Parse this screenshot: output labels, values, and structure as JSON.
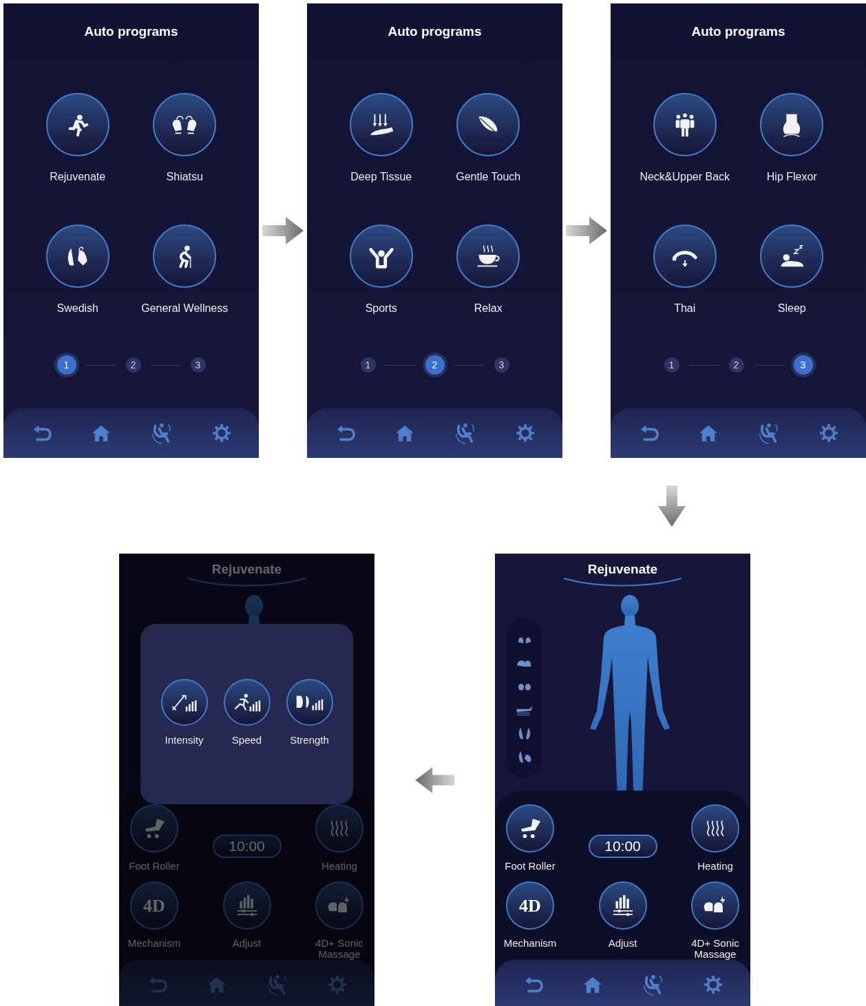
{
  "program_pages": [
    {
      "title": "Auto programs",
      "programs": [
        {
          "label": "Rejuvenate"
        },
        {
          "label": "Shiatsu"
        },
        {
          "label": "Swedish"
        },
        {
          "label": "General Wellness"
        }
      ],
      "pager": [
        {
          "label": "1",
          "selected": true
        },
        {
          "label": "2",
          "selected": false
        },
        {
          "label": "3",
          "selected": false
        }
      ]
    },
    {
      "title": "Auto programs",
      "programs": [
        {
          "label": "Deep Tissue"
        },
        {
          "label": "Gentle Touch"
        },
        {
          "label": "Sports"
        },
        {
          "label": "Relax"
        }
      ],
      "pager": [
        {
          "label": "1",
          "selected": false
        },
        {
          "label": "2",
          "selected": true
        },
        {
          "label": "3",
          "selected": false
        }
      ]
    },
    {
      "title": "Auto programs",
      "programs": [
        {
          "label": "Neck&Upper Back"
        },
        {
          "label": "Hip Flexor"
        },
        {
          "label": "Thai"
        },
        {
          "label": "Sleep"
        }
      ],
      "pager": [
        {
          "label": "1",
          "selected": false
        },
        {
          "label": "2",
          "selected": false
        },
        {
          "label": "3",
          "selected": true
        }
      ]
    }
  ],
  "program_screens": [
    {
      "title": "Rejuvenate",
      "dimmed": true,
      "timer": "10:00",
      "controls": [
        {
          "label": "Foot Roller"
        },
        {
          "label": "Heating"
        },
        {
          "label": "Mechanism",
          "icon_text": "4D"
        },
        {
          "label": "Adjust"
        },
        {
          "label": "4D+ Sonic Massage"
        }
      ],
      "dialog": {
        "options": [
          {
            "label": "Intensity"
          },
          {
            "label": "Speed"
          },
          {
            "label": "Strength"
          }
        ]
      }
    },
    {
      "title": "Rejuvenate",
      "dimmed": false,
      "timer": "10:00",
      "controls": [
        {
          "label": "Foot Roller"
        },
        {
          "label": "Heating"
        },
        {
          "label": "Mechanism",
          "icon_text": "4D"
        },
        {
          "label": "Adjust"
        },
        {
          "label": "4D+ Sonic Massage"
        }
      ]
    }
  ]
}
